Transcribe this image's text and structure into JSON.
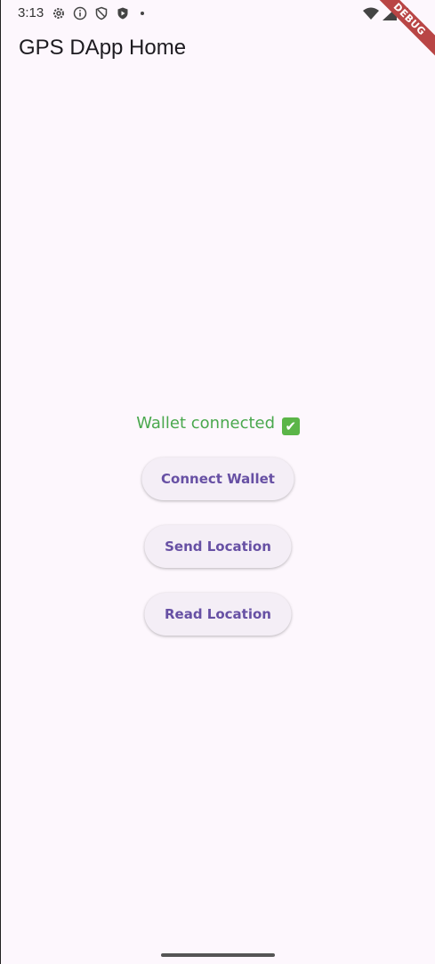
{
  "status_bar": {
    "time": "3:13",
    "icons_left": [
      "gear-icon",
      "info-icon",
      "shield-icon",
      "play-shield-icon",
      "dot-icon"
    ],
    "icons_right": [
      "wifi-icon",
      "signal-icon",
      "battery-icon"
    ]
  },
  "debug_banner": {
    "label": "DEBUG",
    "color": "#b94545"
  },
  "app_bar": {
    "title": "GPS DApp Home"
  },
  "main": {
    "wallet_status": "Wallet connected",
    "wallet_status_color": "#4aa84e",
    "wallet_status_icon": "check-mark-icon",
    "buttons": [
      {
        "label": "Connect Wallet"
      },
      {
        "label": "Send Location"
      },
      {
        "label": "Read Location"
      }
    ]
  },
  "colors": {
    "background": "#fdf7fd",
    "button_bg": "#f4eef6",
    "button_text": "#6750a4"
  }
}
